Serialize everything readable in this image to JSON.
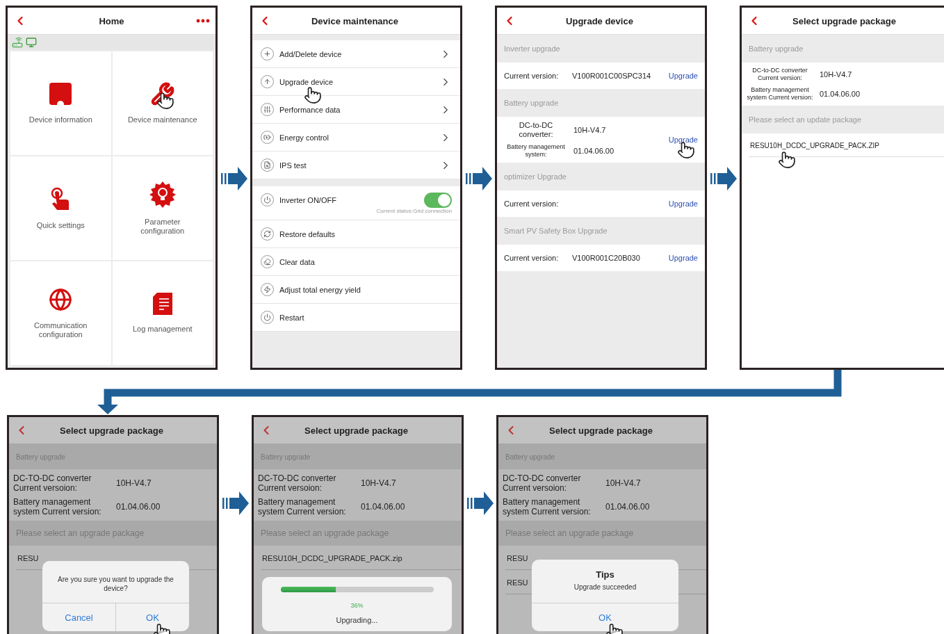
{
  "rows": [
    [
      {
        "kind": "home",
        "title": "Home",
        "tiles": [
          {
            "label": "Device information",
            "tapped": false
          },
          {
            "label": "Device maintenance",
            "tapped": true
          },
          {
            "label": "Quick settings",
            "tapped": false
          },
          {
            "label": "Parameter configuration",
            "tapped": false
          },
          {
            "label": "Communication configuration",
            "tapped": false
          },
          {
            "label": "Log management",
            "tapped": false
          }
        ]
      },
      {
        "kind": "menu",
        "title": "Device maintenance",
        "groups": [
          [
            {
              "kind": "link",
              "label": "Add/Delete device",
              "tapped": false
            },
            {
              "kind": "link",
              "label": "Upgrade device",
              "tapped": true
            },
            {
              "kind": "link",
              "label": "Performance data",
              "tapped": false
            },
            {
              "kind": "link",
              "label": "Energy control",
              "tapped": false
            },
            {
              "kind": "link",
              "label": "IPS test",
              "tapped": false
            }
          ],
          [
            {
              "kind": "toggle",
              "label": "Inverter ON/OFF",
              "on": true,
              "status": "Current status:Grid connection"
            },
            {
              "kind": "action",
              "label": "Restore defaults",
              "tapped": false
            },
            {
              "kind": "action",
              "label": "Clear data",
              "tapped": false
            },
            {
              "kind": "action",
              "label": "Adjust total energy yield",
              "tapped": false
            },
            {
              "kind": "action",
              "label": "Restart",
              "tapped": false
            }
          ]
        ]
      },
      {
        "kind": "versions",
        "title": "Upgrade device",
        "sections": [
          {
            "header": "Inverter upgrade",
            "rows": [
              {
                "label": "Current version:",
                "value": "V100R001C00SPC314"
              }
            ],
            "action": {
              "label": "Upgrade",
              "tapped": false
            }
          },
          {
            "header": "Battery upgrade",
            "rows": [
              {
                "label": "DC-to-DC converter:",
                "value": "10H-V4.7"
              },
              {
                "label": "Battery management system:",
                "value": "01.04.06.00"
              }
            ],
            "action": {
              "label": "Upgrade",
              "tapped": true
            }
          },
          {
            "header": "optimizer Upgrade",
            "rows": [
              {
                "label": "Current version:"
              }
            ],
            "action": {
              "label": "Upgrade",
              "tapped": false
            }
          },
          {
            "header": "Smart PV Safety Box Upgrade",
            "rows": [
              {
                "label": "Current version:",
                "value": "V100R001C20B030"
              }
            ],
            "action": {
              "label": "Upgrade",
              "tapped": false
            }
          }
        ]
      },
      {
        "kind": "package",
        "title": "Select upgrade package",
        "dimmed": false,
        "section": "Battery upgrade",
        "versions": [
          {
            "label": "DC-to-DC converter Current version:",
            "value": "10H-V4.7"
          },
          {
            "label": "Battery management system Current version:",
            "value": "01.04.06.00"
          }
        ],
        "prompt": "Please select an update package",
        "packages": [
          {
            "name": "RESU10H_DCDC_UPGRADE_PACK.ZIP",
            "tapped": true
          }
        ]
      }
    ],
    [
      {
        "kind": "package",
        "title": "Select upgrade package",
        "dimmed": true,
        "section": "Battery upgrade",
        "versions": [
          {
            "label": "DC-TO-DC converter Current versoion:",
            "value": "10H-V4.7"
          },
          {
            "label": "Battery management system Current version:",
            "value": "01.04.06.00"
          }
        ],
        "prompt": "Please select an upgrade package",
        "packages": [
          {
            "name": "RESU"
          }
        ],
        "overlay": {
          "kind": "confirm",
          "message": "Are you sure you want to upgrade the device?",
          "buttons": [
            {
              "label": "Cancel",
              "tapped": false
            },
            {
              "label": "OK",
              "tapped": true
            }
          ]
        }
      },
      {
        "kind": "package",
        "title": "Select upgrade package",
        "dimmed": true,
        "section": "Battery upgrade",
        "versions": [
          {
            "label": "DC-TO-DC converter Current versoion:",
            "value": "10H-V4.7"
          },
          {
            "label": "Battery management system Current version:",
            "value": "01.04.06.00"
          }
        ],
        "prompt": "Please select an upgrade package",
        "packages": [
          {
            "name": "RESU10H_DCDC_UPGRADE_PACK.zip"
          }
        ],
        "overlay": {
          "kind": "progress",
          "level": 0.36,
          "percent": "36%",
          "message": "Upgrading..."
        }
      },
      {
        "kind": "package",
        "title": "Select upgrade package",
        "dimmed": true,
        "section": "Battery upgrade",
        "versions": [
          {
            "label": "DC-TO-DC converter Current versoion:",
            "value": "10H-V4.7"
          },
          {
            "label": "Battery management system Current version:",
            "value": "01.04.06.00"
          }
        ],
        "prompt": "Please select an upgrade package",
        "packages": [
          {
            "name": "RESU"
          },
          {
            "name": "RESU"
          }
        ],
        "overlay": {
          "kind": "alert",
          "title": "Tips",
          "message": "Upgrade succeeded",
          "buttons": [
            {
              "label": "OK",
              "tapped": true
            }
          ]
        }
      }
    ]
  ]
}
